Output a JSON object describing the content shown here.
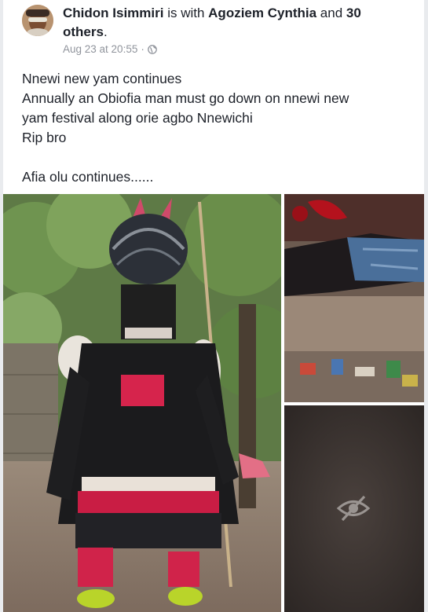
{
  "post": {
    "author": "Chidon Isimmiri",
    "with_text": " is with ",
    "tagged": "Agoziem Cynthia",
    "and_text": " and ",
    "others": "30 others",
    "period": ".",
    "timestamp": "Aug 23 at 20:55",
    "separator": "·",
    "privacy_icon": "globe-icon",
    "body_lines": [
      "Nnewi new yam continues",
      "Annually an Obiofia man must go down on nnewi new",
      "yam festival along orie agbo Nnewichi",
      "Rip bro",
      "",
      "Afia olu continues......"
    ]
  },
  "photos": {
    "count": 3,
    "hidden_overlay_icon": "eye-slash-icon"
  },
  "colors": {
    "name_text": "#1d2129",
    "meta_text": "#90949c",
    "background": "#e9ebee",
    "card": "#ffffff"
  }
}
